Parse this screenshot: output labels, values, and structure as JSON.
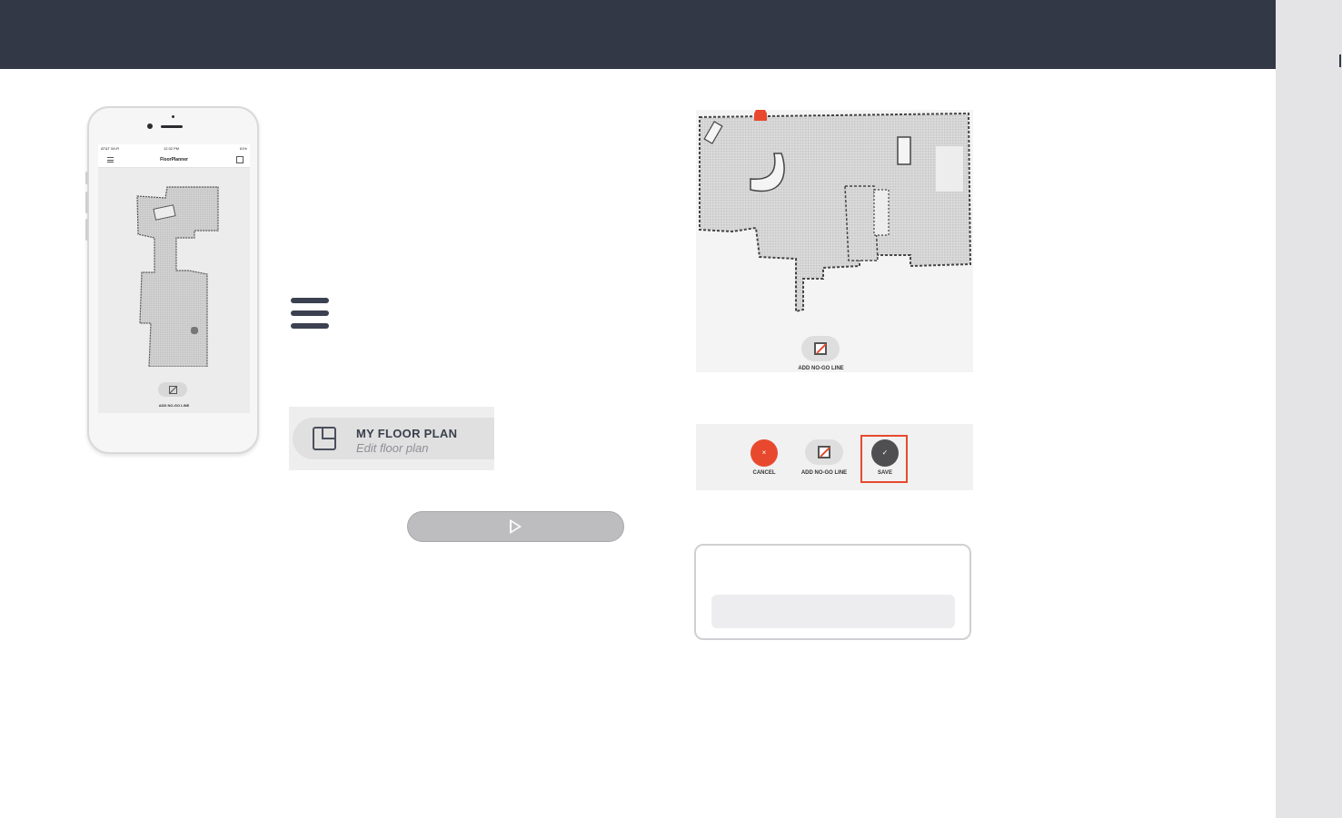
{
  "phone": {
    "status": {
      "carrier": "AT&T Wi-Fi",
      "time": "12:32 PM",
      "battery": "61%"
    },
    "app_title": "FloorPlanner",
    "nogo_label": "ADD NO-GO LINE"
  },
  "menu": {
    "icon": "hamburger-menu-icon"
  },
  "floor_plan_card": {
    "icon": "floor-plan-icon",
    "title": "MY FLOOR PLAN",
    "subtitle": "Edit floor plan"
  },
  "play_button": {
    "icon": "play-icon"
  },
  "big_map": {
    "robot_color": "#e8492e",
    "nogo_label": "ADD NO-GO LINE"
  },
  "action_bar": {
    "cancel_symbol": "×",
    "cancel_label": "CANCEL",
    "nogo_label": "ADD NO-GO LINE",
    "save_symbol": "✓",
    "save_label": "SAVE",
    "highlight_color": "#e8492e"
  },
  "colors": {
    "header": "#323846",
    "accent": "#e8492e",
    "side_strip": "#e4e3e6"
  }
}
